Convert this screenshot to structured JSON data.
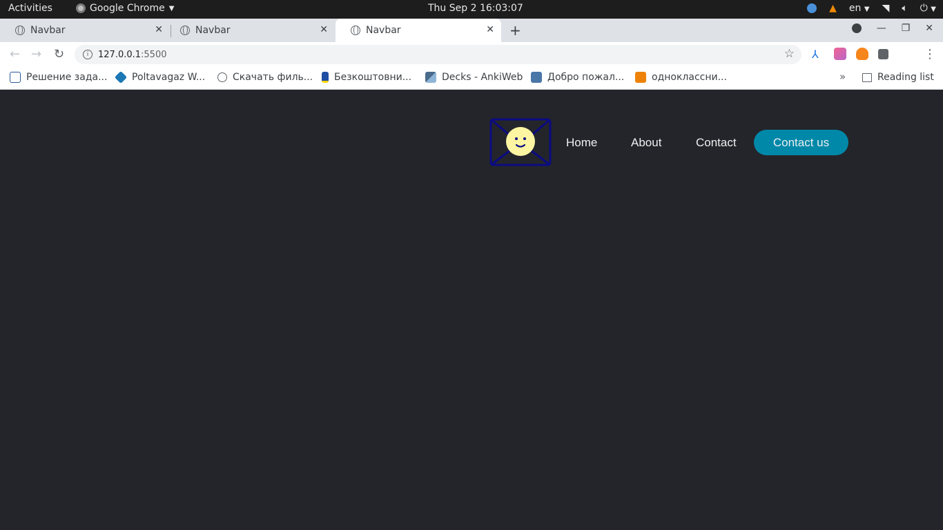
{
  "system_bar": {
    "activities": "Activities",
    "app_name": "Google Chrome",
    "clock": "Thu Sep 2  16:03:07",
    "language": "en"
  },
  "tabs": [
    {
      "title": "Navbar",
      "active": false
    },
    {
      "title": "Navbar",
      "active": false
    },
    {
      "title": "Navbar",
      "active": true
    }
  ],
  "address_bar": {
    "host": "127.0.0.1",
    "port": ":5500"
  },
  "bookmarks": [
    {
      "label": "Решение зада...",
      "icon": "bookmark-favicon",
      "color": "#2b5797"
    },
    {
      "label": "Poltavagaz W...",
      "icon": "bookmark-favicon",
      "color": "#1b78b5"
    },
    {
      "label": "Скачать филь...",
      "icon": "globe-icon",
      "color": "#5f6368"
    },
    {
      "label": "Безкоштовни...",
      "icon": "trident-icon",
      "color": "#1f4fa3"
    },
    {
      "label": "Decks - AnkiWeb",
      "icon": "anki-icon",
      "color": "#4a6c8c"
    },
    {
      "label": "Добро пожал...",
      "icon": "vk-icon",
      "color": "#4a76a8"
    },
    {
      "label": "однокласcни...",
      "icon": "ok-icon",
      "color": "#ee8208"
    }
  ],
  "reading_list": "Reading list",
  "site": {
    "nav_links": [
      "Home",
      "About",
      "Contact"
    ],
    "cta": "Contact us",
    "colors": {
      "background": "#24252a",
      "cta": "#0088a9",
      "link": "#edf0f1",
      "logo_stroke": "#0b0b82",
      "logo_face": "#fdf5a2"
    }
  }
}
